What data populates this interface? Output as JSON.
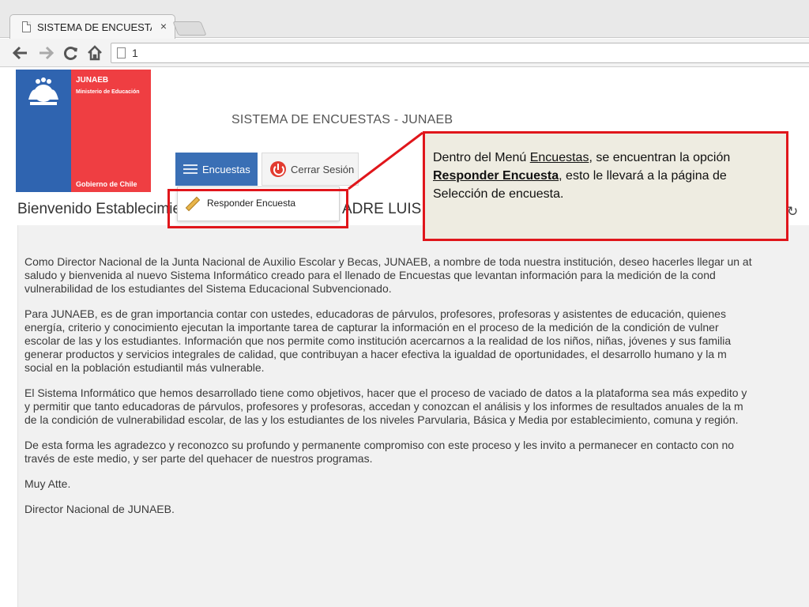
{
  "browser": {
    "tab_title": "SISTEMA DE ENCUESTAS - ...",
    "tab_close": "×",
    "url": "1",
    "icons": [
      "document-icon",
      "close-icon",
      "back-arrow-icon",
      "forward-arrow-icon",
      "reload-icon",
      "home-icon"
    ]
  },
  "logo": {
    "org": "JUNAEB",
    "ministry": "Ministerio de Educación",
    "government": "Gobierno de Chile",
    "colors": {
      "blue": "#2f64b0",
      "red": "#ef3e42"
    }
  },
  "header": {
    "system_title": "SISTEMA DE ENCUESTAS - JUNAEB"
  },
  "nav": {
    "encuestas_label": "Encuestas",
    "cerrar_label": "Cerrar Sesión"
  },
  "dropdown": {
    "responder_label": "Responder Encuesta"
  },
  "welcome": {
    "visible_left": "Bienvenido Establecimie",
    "visible_right": "ADRE LUIS E"
  },
  "callout": {
    "text_1": "Dentro del Menú ",
    "link_1": "Encuestas",
    "text_2": ", se encuentran la opción ",
    "link_2": "Responder Encuesta",
    "text_3": ", esto le llevará  a la página de Selección de encuesta."
  },
  "letter": {
    "p1": [
      "Como Director Nacional de la Junta Nacional de Auxilio Escolar y Becas, JUNAEB, a nombre de toda nuestra institución, deseo hacerles llegar un at",
      "saludo y bienvenida al nuevo Sistema Informático creado para el llenado de Encuestas que levantan información para la medición de la cond",
      "vulnerabilidad de los estudiantes del Sistema Educacional Subvencionado."
    ],
    "p2": [
      "Para JUNAEB, es de gran importancia contar con ustedes, educadoras de párvulos, profesores, profesoras y asistentes de educación, quienes",
      "energía, criterio y conocimiento ejecutan la importante tarea de capturar la información en el proceso de la medición de la condición de vulner",
      "escolar de las y los estudiantes. Información que nos permite como institución acercarnos a la realidad de los niños, niñas, jóvenes y sus familia",
      "generar productos y servicios integrales de calidad, que contribuyan a hacer efectiva la igualdad de oportunidades, el desarrollo humano y la m",
      "social en la población estudiantil más vulnerable."
    ],
    "p3": [
      "El Sistema Informático que hemos desarrollado tiene como objetivos, hacer que el proceso de vaciado de datos a la plataforma sea más expedito y",
      "y permitir que tanto educadoras de párvulos, profesores y profesoras, accedan y conozcan el análisis y los informes de resultados anuales de la m",
      "de la condición de vulnerabilidad escolar, de las y los estudiantes de los niveles Parvularia, Básica y Media por establecimiento, comuna y región."
    ],
    "p4": [
      "De esta forma les agradezco y reconozco su profundo y permanente compromiso con este proceso y les invito a permanecer en contacto con no",
      "través de este medio, y ser parte del quehacer de nuestros programas."
    ],
    "closing": "Muy Atte.",
    "signature": "Director Nacional de JUNAEB."
  }
}
